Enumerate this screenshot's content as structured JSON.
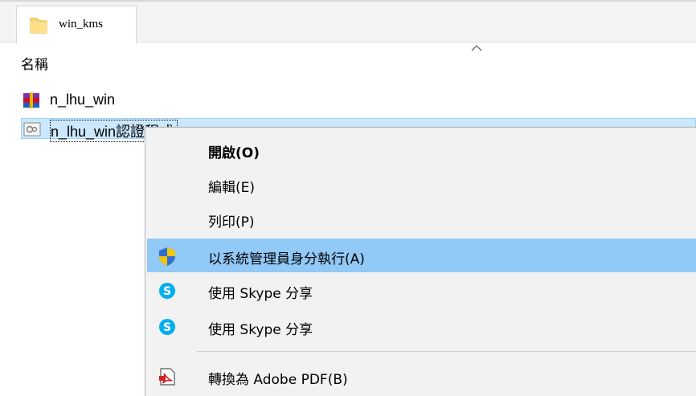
{
  "tab": {
    "label": "win_kms",
    "icon": "folder-icon"
  },
  "list": {
    "column_header": "名稱",
    "sort_indicator": "chevron-up-icon",
    "files": [
      {
        "name": "n_lhu_win",
        "icon": "winrar-archive-icon"
      },
      {
        "name": "n_lhu_win認證程式",
        "icon": "script-file-icon",
        "selected": true
      }
    ]
  },
  "context_menu": {
    "items": [
      {
        "label": "開啟(O)",
        "bold": true
      },
      {
        "label": "編輯(E)"
      },
      {
        "label": "列印(P)"
      },
      {
        "label": "以系統管理員身分執行(A)",
        "icon": "uac-shield-icon",
        "highlighted": true
      },
      {
        "label": "使用 Skype 分享",
        "icon": "skype-icon"
      },
      {
        "label": "使用 Skype 分享",
        "icon": "skype-icon"
      },
      {
        "label": "轉換為 Adobe PDF(B)",
        "icon": "adobe-pdf-icon"
      }
    ]
  },
  "colors": {
    "selection_bg": "#cce8ff",
    "menu_highlight": "#91c9f7",
    "menu_bg": "#f2f2f2",
    "skype_blue": "#00aff0",
    "shield_blue": "#2f6fd1",
    "shield_yellow": "#f5c400"
  }
}
